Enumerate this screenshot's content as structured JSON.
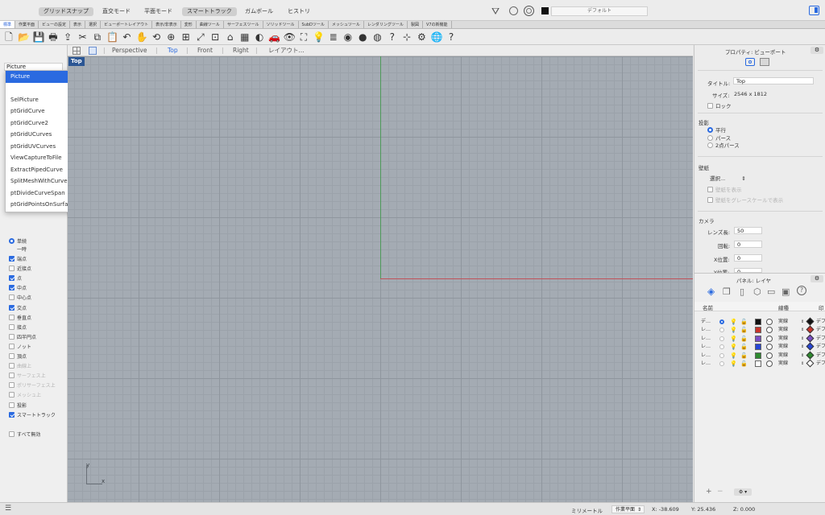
{
  "topbar": {
    "buttons": [
      {
        "label": "グリッドスナップ",
        "active": true
      },
      {
        "label": "直交モード",
        "active": false
      },
      {
        "label": "平面モード",
        "active": false
      },
      {
        "label": "スマートトラック",
        "active": true
      },
      {
        "label": "ガムボール",
        "active": false
      },
      {
        "label": "ヒストリ",
        "active": false
      }
    ],
    "layer_name": "デフォルト"
  },
  "tabs": [
    "標準",
    "作業平面",
    "ビューの設定",
    "表示",
    "選択",
    "ビューポートレイアウト",
    "表示/非表示",
    "変形",
    "曲線ツール",
    "サーフェスツール",
    "ソリッドツール",
    "SubDツール",
    "メッシュツール",
    "レンダリングツール",
    "製図",
    "V7の新機能"
  ],
  "toolbar_icons": [
    "new-file-icon",
    "open-folder-icon",
    "save-icon",
    "print-icon",
    "import-icon",
    "cut-icon",
    "copy-icon",
    "paste-icon",
    "undo-icon",
    "pan-hand-icon",
    "rotate-view-icon",
    "zoom-icon",
    "zoom-window-icon",
    "zoom-extents-icon",
    "zoom-selected-icon",
    "set-view-icon",
    "grid-icon",
    "shade-icon",
    "car-icon",
    "eye-icon",
    "select-filter-icon",
    "light-bulb-icon",
    "layer-icon",
    "color-wheel-icon",
    "material-icon",
    "render-sphere-icon",
    "help-icon",
    "gumball-icon",
    "options-icon",
    "globe-icon",
    "question-icon"
  ],
  "command": {
    "input_value": "Picture",
    "suggestions": [
      "Picture",
      "SelPicture",
      "ptGridCurve",
      "ptGridCurve2",
      "ptGridUCurves",
      "ptGridUVCurves",
      "ViewCaptureToFile",
      "ExtractPipedCurve",
      "SplitMeshWithCurve",
      "ptDivideCurveSpan",
      "ptGridPointsOnSurface"
    ]
  },
  "osnap": {
    "mode": [
      {
        "label": "単続",
        "selected": true
      },
      {
        "label": "一時",
        "selected": false
      }
    ],
    "items": [
      {
        "label": "端点",
        "checked": true,
        "disabled": false
      },
      {
        "label": "近接点",
        "checked": false,
        "disabled": false
      },
      {
        "label": "点",
        "checked": true,
        "disabled": false
      },
      {
        "label": "中点",
        "checked": true,
        "disabled": false
      },
      {
        "label": "中心点",
        "checked": false,
        "disabled": false
      },
      {
        "label": "交点",
        "checked": true,
        "disabled": false
      },
      {
        "label": "垂直点",
        "checked": false,
        "disabled": false
      },
      {
        "label": "接点",
        "checked": false,
        "disabled": false
      },
      {
        "label": "四半円点",
        "checked": false,
        "disabled": false
      },
      {
        "label": "ノット",
        "checked": false,
        "disabled": false
      },
      {
        "label": "頂点",
        "checked": false,
        "disabled": false
      },
      {
        "label": "曲線上",
        "checked": false,
        "disabled": true
      },
      {
        "label": "サーフェス上",
        "checked": false,
        "disabled": true
      },
      {
        "label": "ポリサーフェス上",
        "checked": false,
        "disabled": true
      },
      {
        "label": "メッシュ上",
        "checked": false,
        "disabled": true
      },
      {
        "label": "投影",
        "checked": false,
        "disabled": false
      },
      {
        "label": "スマートトラック",
        "checked": true,
        "disabled": false
      }
    ],
    "disable_all": "すべて無効"
  },
  "viewport_tabs": [
    {
      "label": "Perspective",
      "active": false
    },
    {
      "label": "Top",
      "active": true
    },
    {
      "label": "Front",
      "active": false
    },
    {
      "label": "Right",
      "active": false
    },
    {
      "label": "レイアウト...",
      "active": false
    }
  ],
  "viewport": {
    "label": "Top",
    "axis_y": "y",
    "axis_x": "x",
    "grid_color": "#a4abb3",
    "x_axis_color": "#c0525a",
    "y_axis_color": "#4e9a5a"
  },
  "properties": {
    "title": "プロパティ: ビューポート",
    "title_label": "タイトル:",
    "title_value": "Top",
    "size_label": "サイズ:",
    "size_value": "2546 x 1812",
    "lock_label": "ロック",
    "projection_heading": "投影",
    "projection_options": [
      {
        "label": "平行",
        "selected": true
      },
      {
        "label": "パース",
        "selected": false
      },
      {
        "label": "2点パース",
        "selected": false
      }
    ],
    "wallpaper_heading": "壁紙",
    "wallpaper_select": "選択...",
    "wallpaper_show": "壁紙を表示",
    "wallpaper_gray": "壁紙をグレースケールで表示",
    "camera_heading": "カメラ",
    "lens_label": "レンズ長:",
    "lens_value": "50",
    "rotation_label": "回転:",
    "rotation_value": "0",
    "xpos_label": "X位置:",
    "xpos_value": "0",
    "ypos_label": "Y位置:",
    "ypos_value": "0"
  },
  "layers": {
    "title": "パネル: レイヤ",
    "col_name": "名前",
    "col_linetype": "線種",
    "col_print": "印",
    "rows": [
      {
        "name": "デ…",
        "color": "#111111",
        "linetype": "実線",
        "current": true
      },
      {
        "name": "レ…",
        "color": "#c8352c",
        "linetype": "実線",
        "current": false
      },
      {
        "name": "レ…",
        "color": "#7a4fc4",
        "linetype": "実線",
        "current": false
      },
      {
        "name": "レ…",
        "color": "#2746d6",
        "linetype": "実線",
        "current": false
      },
      {
        "name": "レ…",
        "color": "#2f8a2f",
        "linetype": "実線",
        "current": false
      },
      {
        "name": "レ…",
        "color": "#ffffff",
        "linetype": "実線",
        "current": false
      }
    ],
    "row_suffix": "デフ"
  },
  "status": {
    "units": "ミリメートル",
    "cplane": "作業平面",
    "x": "X: -38.609",
    "y": "Y: 25.436",
    "z": "Z: 0.000"
  },
  "colors": {
    "accent": "#2a6ae0",
    "viewport_label_bg": "#2b5694"
  }
}
